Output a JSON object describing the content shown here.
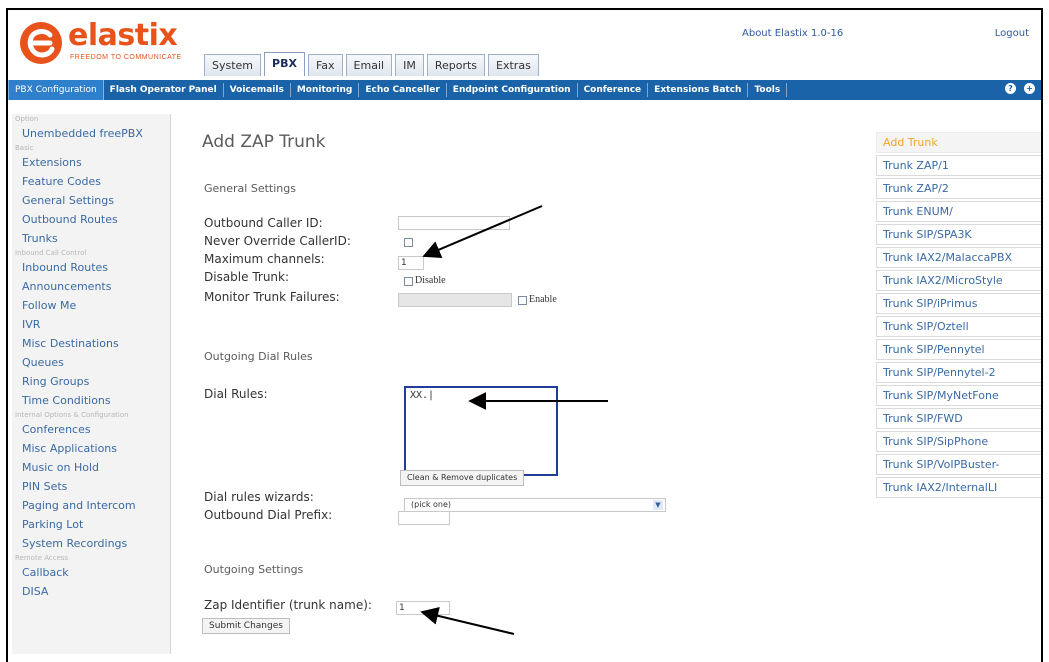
{
  "header": {
    "logo_text": "elastix",
    "logo_tagline": "FREEDOM TO COMMUNICATE",
    "about": "About Elastix 1.0-16",
    "logout": "Logout",
    "tabs": [
      {
        "label": "System"
      },
      {
        "label": "PBX",
        "active": true
      },
      {
        "label": "Fax"
      },
      {
        "label": "Email"
      },
      {
        "label": "IM"
      },
      {
        "label": "Reports"
      },
      {
        "label": "Extras"
      }
    ]
  },
  "navbar": {
    "items": [
      {
        "label": "PBX Configuration",
        "active": true
      },
      {
        "label": "Flash Operator Panel"
      },
      {
        "label": "Voicemails"
      },
      {
        "label": "Monitoring"
      },
      {
        "label": "Echo Canceller"
      },
      {
        "label": "Endpoint Configuration"
      },
      {
        "label": "Conference"
      },
      {
        "label": "Extensions Batch"
      },
      {
        "label": "Tools"
      }
    ],
    "icons": [
      "help-icon",
      "add-icon"
    ]
  },
  "sidebar": {
    "option_cat": "Option",
    "option_items": [
      "Unembedded freePBX"
    ],
    "basic_cat": "Basic",
    "basic_items": [
      "Extensions",
      "Feature Codes",
      "General Settings",
      "Outbound Routes",
      "Trunks"
    ],
    "inbound_cat": "Inbound Call Control",
    "inbound_items": [
      "Inbound Routes",
      "Announcements",
      "Follow Me",
      "IVR",
      "Misc Destinations",
      "Queues",
      "Ring Groups",
      "Time Conditions"
    ],
    "internal_cat": "Internal Options & Configuration",
    "internal_items": [
      "Conferences",
      "Misc Applications",
      "Music on Hold",
      "PIN Sets",
      "Paging and Intercom",
      "Parking Lot",
      "System Recordings"
    ],
    "remote_cat": "Remote Access",
    "remote_items": [
      "Callback",
      "DISA"
    ]
  },
  "main": {
    "title": "Add ZAP Trunk",
    "general_settings": "General Settings",
    "outbound_callerid_label": "Outbound Caller ID:",
    "outbound_callerid_value": "",
    "never_override_label": "Never Override CallerID:",
    "max_channels_label": "Maximum channels:",
    "max_channels_value": "1",
    "disable_trunk_label": "Disable Trunk:",
    "disable_checkbox_label": "Disable",
    "monitor_failures_label": "Monitor Trunk Failures:",
    "monitor_value": "",
    "enable_checkbox_label": "Enable",
    "outgoing_dial_rules": "Outgoing Dial Rules",
    "dial_rules_label": "Dial Rules:",
    "dial_rules_value": "XX.|",
    "clean_button": "Clean & Remove duplicates",
    "wizards_label": "Dial rules wizards:",
    "wizards_value": "(pick one)",
    "dial_prefix_label": "Outbound Dial Prefix:",
    "dial_prefix_value": "",
    "outgoing_settings": "Outgoing Settings",
    "zap_identifier_label": "Zap Identifier (trunk name):",
    "zap_identifier_value": "1",
    "submit_button": "Submit Changes"
  },
  "trunks": {
    "header": "Add Trunk",
    "items": [
      "Trunk ZAP/1",
      "Trunk ZAP/2",
      "Trunk ENUM/",
      "Trunk SIP/SPA3K",
      "Trunk IAX2/MalaccaPBX",
      "Trunk IAX2/MicroStyle",
      "Trunk SIP/iPrimus",
      "Trunk SIP/Oztell",
      "Trunk SIP/Pennytel",
      "Trunk SIP/Pennytel-2",
      "Trunk SIP/MyNetFone",
      "Trunk SIP/FWD",
      "Trunk SIP/SipPhone",
      "Trunk SIP/VoIPBuster-",
      "Trunk IAX2/InternalLI"
    ]
  },
  "colors": {
    "brand": "#e8531c",
    "navbar": "#1b63a8",
    "link": "#3a6aa3",
    "trunk_header": "#f5a623"
  }
}
